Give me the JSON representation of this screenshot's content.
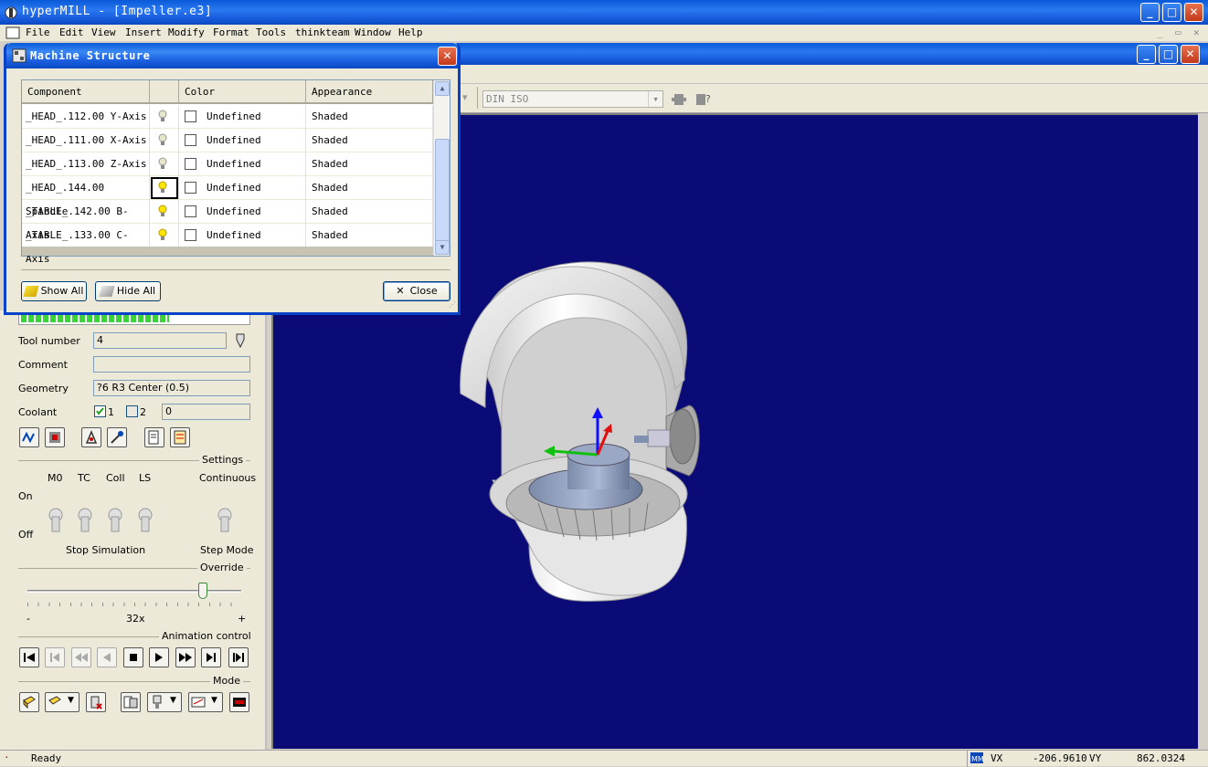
{
  "app": {
    "title": "hyperMILL - [Impeller.e3]"
  },
  "menu": [
    {
      "label": "File"
    },
    {
      "label": "Edit"
    },
    {
      "label": "View"
    },
    {
      "label": "Insert"
    },
    {
      "label": "Modify"
    },
    {
      "label": "Format"
    },
    {
      "label": "Tools"
    },
    {
      "label": "thinkteam"
    },
    {
      "label": "Window"
    },
    {
      "label": "Help"
    }
  ],
  "toolbar": {
    "postprocessor": "DIN ISO"
  },
  "dialog": {
    "title": "Machine Structure",
    "columns": [
      "Component",
      "",
      "Color",
      "Appearance"
    ],
    "rows": [
      {
        "component": "_HEAD_.112.00 Y-Axis",
        "visible": false,
        "color": "Undefined",
        "appearance": "Shaded"
      },
      {
        "component": "_HEAD_.111.00 X-Axis",
        "visible": false,
        "color": "Undefined",
        "appearance": "Shaded"
      },
      {
        "component": "_HEAD_.113.00 Z-Axis",
        "visible": false,
        "color": "Undefined",
        "appearance": "Shaded"
      },
      {
        "component": "_HEAD_.144.00 Spindle",
        "visible": true,
        "color": "Undefined",
        "appearance": "Shaded"
      },
      {
        "component": "_TABLE_.142.00 B-Axis",
        "visible": true,
        "color": "Undefined",
        "appearance": "Shaded"
      },
      {
        "component": "_TABLE_.133.00 C-Axis",
        "visible": true,
        "color": "Undefined",
        "appearance": "Shaded"
      }
    ],
    "show_all": "Show All",
    "hide_all": "Hide All",
    "close": "Close"
  },
  "panel": {
    "tool_number_label": "Tool number",
    "tool_number": "4",
    "comment_label": "Comment",
    "comment": "",
    "geometry_label": "Geometry",
    "geometry": "?6  R3  Center  (0.5)",
    "coolant_label": "Coolant",
    "coolant_1": "1",
    "coolant_2": "2",
    "coolant_value": "0",
    "settings_label": "Settings",
    "m0": "M0",
    "tc": "TC",
    "coll": "Coll",
    "ls": "LS",
    "continuous": "Continuous",
    "on": "On",
    "off": "Off",
    "stop_simulation": "Stop Simulation",
    "step_mode": "Step Mode",
    "override_label": "Override",
    "override_min": "-",
    "override_value": "32x",
    "override_max": "+",
    "override_fraction": 0.82,
    "animation_label": "Animation control",
    "mode_label": "Mode"
  },
  "status": {
    "text": "Ready",
    "vx_label": "VX",
    "vx": "-206.9610",
    "vy_label": "VY",
    "vy": "862.0324"
  },
  "colors": {
    "viewport": "#0b0b78",
    "xp_blue": "#0a59d8",
    "progress_green": "#3ad33a"
  }
}
